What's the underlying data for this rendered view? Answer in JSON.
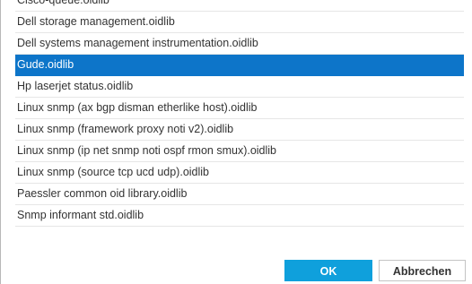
{
  "list": {
    "items": [
      "Cisco-queue.oidlib",
      "Dell storage management.oidlib",
      "Dell systems management instrumentation.oidlib",
      "Gude.oidlib",
      "Hp laserjet status.oidlib",
      "Linux snmp (ax bgp disman etherlike host).oidlib",
      "Linux snmp (framework proxy noti v2).oidlib",
      "Linux snmp (ip net snmp noti ospf rmon smux).oidlib",
      "Linux snmp (source tcp ucd udp).oidlib",
      "Paessler common oid library.oidlib",
      "Snmp informant std.oidlib"
    ],
    "selected_index": 3
  },
  "buttons": {
    "ok_label": "OK",
    "cancel_label": "Abbrechen"
  },
  "colors": {
    "selection": "#0d75c9",
    "ok_button": "#0fa0dc"
  }
}
